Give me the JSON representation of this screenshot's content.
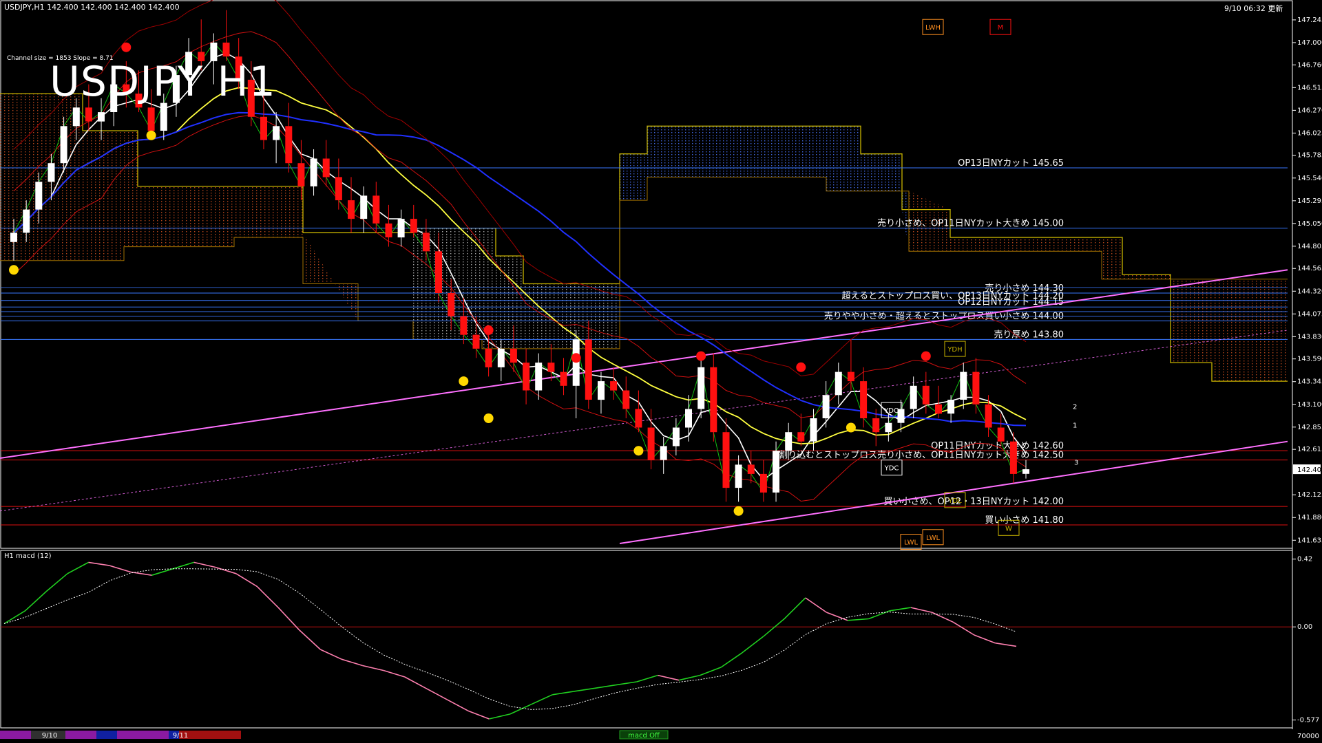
{
  "header": {
    "symbol_info": "USDJPY,H1  142.400 142.400 142.400 142.400",
    "timestamp": "9/10 06:32 更新",
    "channel_info": "Channel size = 1853 Slope = 8.71",
    "big_title": "USDJPY H1",
    "indicator_label": "H1  macd (12)"
  },
  "price_axis": {
    "ticks": [
      "147.245",
      "147.000",
      "146.760",
      "146.515",
      "146.270",
      "146.025",
      "145.785",
      "145.540",
      "145.295",
      "145.050",
      "144.805",
      "144.565",
      "144.320",
      "144.075",
      "143.830",
      "143.590",
      "143.345",
      "143.100",
      "142.855",
      "142.615",
      "142.125",
      "141.880",
      "141.635"
    ],
    "current_price": "142.400",
    "range": [
      141.6,
      147.4
    ]
  },
  "macd_axis": {
    "ticks": [
      "0.42",
      "0.00",
      "-0.577"
    ],
    "range": [
      -0.6,
      0.44
    ]
  },
  "bottom_bar": {
    "date_labels": [
      "9/10",
      "9/11"
    ],
    "left_value": "70000",
    "center_label": "macd Off"
  },
  "levels": [
    {
      "label": "OP13日NYカット 145.65",
      "price": 145.65,
      "color": "#3a78ff"
    },
    {
      "label": "売り小さめ、OP11日NYカット大きめ 145.00",
      "price": 145.0,
      "color": "#3a78ff"
    },
    {
      "label": "売り小さめ 144.30",
      "price": 144.3,
      "color": "#3a78ff"
    },
    {
      "label": "超えるとストップロス買い、OP13日NYカット 144.20",
      "price": 144.22,
      "color": "#3a78ff"
    },
    {
      "label": "OP12日NYカット 144.15",
      "price": 144.15,
      "color": "#3a78ff"
    },
    {
      "label": "売りやや小さめ・超えるとストップロス買い小さめ 144.00",
      "price": 144.0,
      "color": "#3a78ff"
    },
    {
      "label": "売り厚め 143.80",
      "price": 143.8,
      "color": "#3a78ff"
    },
    {
      "label": "OP11日NYカット大きめ 142.60",
      "price": 142.6,
      "color": "#e01010"
    },
    {
      "label": "割り込むとストップロス売り小さめ、OP11日NYカット大きめ 142.50",
      "price": 142.5,
      "color": "#e01010"
    },
    {
      "label": "買い小さめ、OP12・13日NYカット 142.00",
      "price": 142.0,
      "color": "#e01010"
    },
    {
      "label": "買い小さめ 141.80",
      "price": 141.8,
      "color": "#e01010"
    }
  ],
  "markers": {
    "box_labels": [
      "LWH",
      "M",
      "YDH",
      "YDO",
      "YDC",
      "YDL",
      "LWL",
      "W",
      "LWL"
    ],
    "proj_labels": [
      "2",
      "1",
      "3"
    ]
  },
  "chart_data": {
    "type": "candlestick",
    "title": "USDJPY H1",
    "series": [
      {
        "name": "USDJPY H1",
        "values": [
          [
            144.85,
            145.1,
            144.65,
            144.95
          ],
          [
            144.95,
            145.3,
            144.85,
            145.2
          ],
          [
            145.2,
            145.6,
            145.05,
            145.5
          ],
          [
            145.5,
            145.8,
            145.3,
            145.7
          ],
          [
            145.7,
            146.2,
            145.6,
            146.1
          ],
          [
            146.1,
            146.4,
            145.95,
            146.3
          ],
          [
            146.3,
            146.55,
            146.05,
            146.15
          ],
          [
            146.15,
            146.4,
            145.95,
            146.25
          ],
          [
            146.25,
            146.65,
            146.1,
            146.55
          ],
          [
            146.55,
            146.8,
            146.3,
            146.45
          ],
          [
            146.45,
            146.7,
            146.25,
            146.3
          ],
          [
            146.3,
            146.5,
            145.95,
            146.05
          ],
          [
            146.05,
            146.45,
            145.95,
            146.35
          ],
          [
            146.35,
            146.75,
            146.2,
            146.65
          ],
          [
            146.65,
            147.05,
            146.5,
            146.9
          ],
          [
            146.9,
            147.25,
            146.7,
            146.8
          ],
          [
            146.8,
            147.1,
            146.55,
            147.0
          ],
          [
            147.0,
            147.35,
            146.8,
            146.85
          ],
          [
            146.85,
            147.05,
            146.5,
            146.6
          ],
          [
            146.6,
            146.8,
            146.1,
            146.2
          ],
          [
            146.2,
            146.45,
            145.85,
            145.95
          ],
          [
            145.95,
            146.25,
            145.7,
            146.1
          ],
          [
            146.1,
            146.35,
            145.6,
            145.7
          ],
          [
            145.7,
            145.95,
            145.3,
            145.45
          ],
          [
            145.45,
            145.85,
            145.35,
            145.75
          ],
          [
            145.75,
            145.95,
            145.45,
            145.55
          ],
          [
            145.55,
            145.75,
            145.2,
            145.3
          ],
          [
            145.3,
            145.55,
            144.95,
            145.1
          ],
          [
            145.1,
            145.45,
            144.95,
            145.35
          ],
          [
            145.35,
            145.5,
            144.95,
            145.05
          ],
          [
            145.05,
            145.25,
            144.8,
            144.9
          ],
          [
            144.9,
            145.2,
            144.8,
            145.1
          ],
          [
            145.1,
            145.25,
            144.9,
            144.95
          ],
          [
            144.95,
            145.1,
            144.65,
            144.75
          ],
          [
            144.75,
            144.95,
            144.2,
            144.3
          ],
          [
            144.3,
            144.45,
            143.9,
            144.05
          ],
          [
            144.05,
            144.25,
            143.75,
            143.85
          ],
          [
            143.85,
            144.05,
            143.6,
            143.7
          ],
          [
            143.7,
            143.85,
            143.4,
            143.5
          ],
          [
            143.5,
            143.8,
            143.35,
            143.7
          ],
          [
            143.7,
            143.95,
            143.45,
            143.55
          ],
          [
            143.55,
            143.7,
            143.1,
            143.25
          ],
          [
            143.25,
            143.65,
            143.15,
            143.55
          ],
          [
            143.55,
            143.75,
            143.35,
            143.45
          ],
          [
            143.45,
            143.6,
            143.2,
            143.3
          ],
          [
            143.3,
            143.9,
            142.95,
            143.8
          ],
          [
            143.8,
            144.0,
            143.05,
            143.15
          ],
          [
            143.15,
            143.45,
            143.0,
            143.35
          ],
          [
            143.35,
            143.5,
            143.15,
            143.25
          ],
          [
            143.25,
            143.4,
            142.95,
            143.05
          ],
          [
            143.05,
            143.25,
            142.8,
            142.85
          ],
          [
            142.85,
            143.05,
            142.4,
            142.5
          ],
          [
            142.5,
            142.75,
            142.35,
            142.65
          ],
          [
            142.65,
            142.95,
            142.55,
            142.85
          ],
          [
            142.85,
            143.2,
            142.7,
            143.05
          ],
          [
            143.05,
            143.6,
            142.95,
            143.5
          ],
          [
            143.5,
            143.65,
            142.7,
            142.8
          ],
          [
            142.8,
            142.95,
            142.05,
            142.2
          ],
          [
            142.2,
            142.55,
            142.05,
            142.45
          ],
          [
            142.45,
            142.6,
            142.25,
            142.35
          ],
          [
            142.35,
            142.5,
            142.05,
            142.15
          ],
          [
            142.15,
            142.7,
            142.05,
            142.6
          ],
          [
            142.6,
            142.9,
            142.5,
            142.8
          ],
          [
            142.8,
            143.0,
            142.65,
            142.7
          ],
          [
            142.7,
            143.05,
            142.6,
            142.95
          ],
          [
            142.95,
            143.35,
            142.85,
            143.2
          ],
          [
            143.2,
            143.55,
            143.1,
            143.45
          ],
          [
            143.45,
            143.8,
            143.25,
            143.35
          ],
          [
            143.35,
            143.5,
            142.85,
            142.95
          ],
          [
            142.95,
            143.05,
            142.65,
            142.8
          ],
          [
            142.8,
            143.0,
            142.7,
            142.9
          ],
          [
            142.9,
            143.15,
            142.8,
            143.05
          ],
          [
            143.05,
            143.4,
            142.95,
            143.3
          ],
          [
            143.3,
            143.45,
            143.0,
            143.1
          ],
          [
            143.1,
            143.3,
            142.95,
            143.0
          ],
          [
            143.0,
            143.2,
            142.9,
            143.15
          ],
          [
            143.15,
            143.55,
            143.05,
            143.45
          ],
          [
            143.45,
            143.6,
            143.0,
            143.1
          ],
          [
            143.1,
            143.2,
            142.75,
            142.85
          ],
          [
            142.85,
            143.0,
            142.65,
            142.7
          ],
          [
            142.7,
            142.8,
            142.25,
            142.35
          ],
          [
            142.35,
            142.5,
            142.3,
            142.4
          ]
        ]
      },
      {
        "name": "macd (12)",
        "values": [
          0.02,
          0.1,
          0.22,
          0.33,
          0.4,
          0.38,
          0.34,
          0.32,
          0.36,
          0.4,
          0.37,
          0.33,
          0.25,
          0.12,
          -0.02,
          -0.14,
          -0.2,
          -0.24,
          -0.27,
          -0.31,
          -0.38,
          -0.45,
          -0.52,
          -0.57,
          -0.54,
          -0.48,
          -0.42,
          -0.4,
          -0.38,
          -0.36,
          -0.34,
          -0.3,
          -0.33,
          -0.3,
          -0.25,
          -0.16,
          -0.06,
          0.05,
          0.18,
          0.09,
          0.04,
          0.05,
          0.1,
          0.12,
          0.09,
          0.03,
          -0.05,
          -0.1,
          -0.12
        ]
      }
    ]
  }
}
